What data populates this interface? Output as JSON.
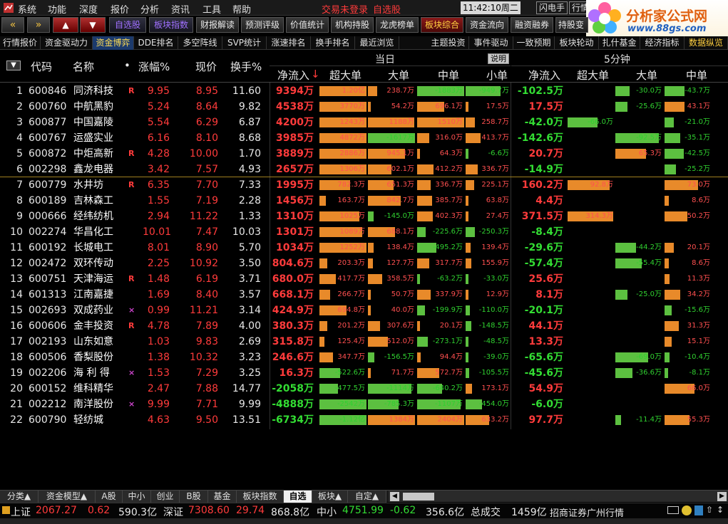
{
  "menubar": {
    "items": [
      "系统",
      "功能",
      "深度",
      "报价",
      "分析",
      "资讯",
      "工具",
      "帮助"
    ],
    "trade_status": "交易未登录",
    "watchlist": "自选股",
    "time": "11:42:10",
    "weekday": "周二",
    "right_items": [
      "闪电手",
      "行情",
      "资"
    ]
  },
  "logo": {
    "title": "分析家公式网",
    "url": "www.88gs.com"
  },
  "toolbar": {
    "nav_prev": "«",
    "nav_next": "»",
    "up": "▲",
    "down": "▼",
    "items": [
      "自选股",
      "板块指数",
      "财报解读",
      "预测评级",
      "价值统计",
      "机构持股",
      "龙虎榜单",
      "板块综合",
      "资金流向",
      "融资融券",
      "持股变"
    ]
  },
  "tabs": {
    "items": [
      "行情报价",
      "资金驱动力",
      "资金博弈",
      "DDE排名",
      "多空阵线",
      "SVP统计",
      "涨速排名",
      "换手排名",
      "最近浏览",
      "主题投资",
      "事件驱动",
      "一致预期",
      "板块轮动",
      "扎什基金",
      "经济指标",
      "数据纵览"
    ],
    "active": "资金博弈"
  },
  "header": {
    "group_today": "当日",
    "group_5min": "5分钟",
    "explain": "说明",
    "cols": [
      "代码",
      "名称",
      "涨幅%",
      "现价",
      "换手%",
      "净流入",
      "超大单",
      "大单",
      "中单",
      "小单",
      "净流入",
      "超大单",
      "大单",
      "中单"
    ],
    "dot": "•",
    "sort_arrow": "↓",
    "toggle": "▼"
  },
  "table": {
    "rows": [
      {
        "no": "1",
        "code": "600846",
        "name": "同济科技",
        "flag": "R",
        "chg": "9.95",
        "price": "8.95",
        "turn": "11.60",
        "net": "9394万",
        "xl": "1.20亿",
        "l": "238.7万",
        "m": "-1883万",
        "s": "-949.7万",
        "net5": "-102.5万",
        "xl5": "",
        "l5": "-30.0万",
        "m5": "-43.7万"
      },
      {
        "no": "2",
        "code": "600760",
        "name": "中航黑豹",
        "flag": "",
        "chg": "5.24",
        "price": "8.64",
        "turn": "9.82",
        "net": "4538万",
        "xl": "3770万",
        "l": "54.2万",
        "m": "696.1万",
        "s": "17.5万",
        "net5": "17.5万",
        "xl5": "",
        "l5": "-25.6万",
        "m5": "43.1万"
      },
      {
        "no": "3",
        "code": "600877",
        "name": "中国嘉陵",
        "flag": "",
        "chg": "5.54",
        "price": "6.29",
        "turn": "6.87",
        "net": "4200万",
        "xl": "1243万",
        "l": "1188万",
        "m": "1510万",
        "s": "258.7万",
        "net5": "-42.0万",
        "xl5": "-66.0万",
        "l5": "",
        "m5": "-21.0万"
      },
      {
        "no": "4",
        "code": "600767",
        "name": "运盛实业",
        "flag": "",
        "chg": "6.16",
        "price": "8.10",
        "turn": "8.68",
        "net": "3985万",
        "xl": "4872万",
        "l": "-1617万",
        "m": "316.0万",
        "s": "413.7万",
        "net5": "-142.6万",
        "xl5": "",
        "l5": "-92.5万",
        "m5": "-35.1万"
      },
      {
        "no": "5",
        "code": "600872",
        "name": "中炬高新",
        "flag": "R",
        "chg": "4.28",
        "price": "10.00",
        "turn": "1.70",
        "net": "3889万",
        "xl": "2886万",
        "l": "945.1万",
        "m": "64.3万",
        "s": "-6.6万",
        "net5": "20.7万",
        "xl5": "",
        "l5": "65.3万",
        "m5": "-42.5万"
      },
      {
        "no": "6",
        "code": "002298",
        "name": "鑫龙电器",
        "flag": "",
        "chg": "3.42",
        "price": "7.57",
        "turn": "4.93",
        "net": "2657万",
        "xl": "1306万",
        "l": "602.1万",
        "m": "412.2万",
        "s": "336.7万",
        "net5": "-14.9万",
        "xl5": "",
        "l5": "",
        "m5": "-25.2万"
      },
      {
        "no": "7",
        "code": "600779",
        "name": "水井坊",
        "flag": "R",
        "chg": "6.35",
        "price": "7.70",
        "turn": "7.33",
        "net": "1995万",
        "xl": "782.3万",
        "l": "651.3万",
        "m": "336.7万",
        "s": "225.1万",
        "net5": "160.2万",
        "xl5": "92.8万",
        "l5": "",
        "m5": "73.0万"
      },
      {
        "no": "8",
        "code": "600189",
        "name": "吉林森工",
        "flag": "",
        "chg": "1.55",
        "price": "7.19",
        "turn": "2.28",
        "net": "1456万",
        "xl": "163.7万",
        "l": "842.7万",
        "m": "385.7万",
        "s": "63.8万",
        "net5": "4.4万",
        "xl5": "",
        "l5": "",
        "m5": "8.6万"
      },
      {
        "no": "9",
        "code": "000666",
        "name": "经纬纺机",
        "flag": "",
        "chg": "2.94",
        "price": "11.22",
        "turn": "1.33",
        "net": "1310万",
        "xl": "1025万",
        "l": "-145.0万",
        "m": "402.3万",
        "s": "27.4万",
        "net5": "371.5万",
        "xl5": "314.3万",
        "l5": "",
        "m5": "50.2万"
      },
      {
        "no": "10",
        "code": "002274",
        "name": "华昌化工",
        "flag": "",
        "chg": "10.01",
        "price": "7.47",
        "turn": "10.03",
        "net": "1301万",
        "xl": "1089万",
        "l": "688.1万",
        "m": "-225.6万",
        "s": "-250.3万",
        "net5": "-8.4万",
        "xl5": "",
        "l5": "",
        "m5": ""
      },
      {
        "no": "11",
        "code": "600192",
        "name": "长城电工",
        "flag": "",
        "chg": "8.01",
        "price": "8.90",
        "turn": "5.70",
        "net": "1034万",
        "xl": "1252万",
        "l": "138.4万",
        "m": "-495.2万",
        "s": "139.4万",
        "net5": "-29.6万",
        "xl5": "",
        "l5": "-44.2万",
        "m5": "20.1万"
      },
      {
        "no": "12",
        "code": "002472",
        "name": "双环传动",
        "flag": "",
        "chg": "2.25",
        "price": "10.92",
        "turn": "3.50",
        "net": "804.6万",
        "xl": "203.3万",
        "l": "127.7万",
        "m": "317.7万",
        "s": "155.9万",
        "net5": "-57.4万",
        "xl5": "",
        "l5": "-55.4万",
        "m5": "8.6万"
      },
      {
        "no": "13",
        "code": "600751",
        "name": "天津海运",
        "flag": "R",
        "chg": "1.48",
        "price": "6.19",
        "turn": "3.71",
        "net": "680.0万",
        "xl": "417.7万",
        "l": "358.5万",
        "m": "-63.2万",
        "s": "-33.0万",
        "net5": "25.6万",
        "xl5": "",
        "l5": "",
        "m5": "11.3万"
      },
      {
        "no": "14",
        "code": "601313",
        "name": "江南嘉捷",
        "flag": "",
        "chg": "1.69",
        "price": "8.40",
        "turn": "3.57",
        "net": "668.1万",
        "xl": "266.7万",
        "l": "50.7万",
        "m": "337.9万",
        "s": "12.9万",
        "net5": "8.1万",
        "xl5": "",
        "l5": "-25.0万",
        "m5": "34.2万"
      },
      {
        "no": "15",
        "code": "002693",
        "name": "双成药业",
        "flag": "×",
        "chg": "0.99",
        "price": "11.21",
        "turn": "3.14",
        "net": "424.9万",
        "xl": "694.8万",
        "l": "40.0万",
        "m": "-199.9万",
        "s": "-110.0万",
        "net5": "-20.1万",
        "xl5": "",
        "l5": "",
        "m5": "-15.6万"
      },
      {
        "no": "16",
        "code": "600606",
        "name": "金丰投资",
        "flag": "R",
        "chg": "4.78",
        "price": "7.89",
        "turn": "4.00",
        "net": "380.3万",
        "xl": "201.2万",
        "l": "307.6万",
        "m": "20.1万",
        "s": "-148.5万",
        "net5": "44.1万",
        "xl5": "",
        "l5": "",
        "m5": "31.3万"
      },
      {
        "no": "17",
        "code": "002193",
        "name": "山东如意",
        "flag": "",
        "chg": "1.03",
        "price": "9.83",
        "turn": "2.69",
        "net": "315.8万",
        "xl": "125.4万",
        "l": "512.0万",
        "m": "-273.1万",
        "s": "-48.5万",
        "net5": "13.3万",
        "xl5": "",
        "l5": "",
        "m5": "15.1万"
      },
      {
        "no": "18",
        "code": "600506",
        "name": "香梨股份",
        "flag": "",
        "chg": "1.38",
        "price": "10.32",
        "turn": "3.23",
        "net": "246.6万",
        "xl": "347.7万",
        "l": "-156.5万",
        "m": "94.4万",
        "s": "-39.0万",
        "net5": "-65.6万",
        "xl5": "",
        "l5": "-69.0万",
        "m5": "-10.4万"
      },
      {
        "no": "19",
        "code": "002206",
        "name": "海 利 得",
        "flag": "×",
        "chg": "1.53",
        "price": "7.29",
        "turn": "3.25",
        "net": "16.3万",
        "xl": "-522.6万",
        "l": "71.7万",
        "m": "572.7万",
        "s": "-105.5万",
        "net5": "-45.6万",
        "xl5": "",
        "l5": "-36.6万",
        "m5": "-8.1万"
      },
      {
        "no": "20",
        "code": "600152",
        "name": "维科精华",
        "flag": "",
        "chg": "2.47",
        "price": "7.88",
        "turn": "14.77",
        "net": "-2058万",
        "xl": "-477.5万",
        "l": "-1114万",
        "m": "-640.2万",
        "s": "173.1万",
        "net5": "54.9万",
        "xl5": "",
        "l5": "",
        "m5": "66.0万"
      },
      {
        "no": "21",
        "code": "002212",
        "name": "南洋股份",
        "flag": "×",
        "chg": "9.99",
        "price": "7.71",
        "turn": "9.99",
        "net": "-4888万",
        "xl": "-2542万",
        "l": "-785.3万",
        "m": "-1107万",
        "s": "-454.0万",
        "net5": "-6.0万",
        "xl5": "",
        "l5": "",
        "m5": ""
      },
      {
        "no": "22",
        "code": "600790",
        "name": "轻纺城",
        "flag": "",
        "chg": "4.63",
        "price": "9.50",
        "turn": "13.51",
        "net": "-6734万",
        "xl": "-1.12亿",
        "l": "1384万",
        "m": "2404万",
        "s": "633.2万",
        "net5": "97.7万",
        "xl5": "",
        "l5": "-11.4万",
        "m5": "55.3万"
      }
    ]
  },
  "bottom_tabs": {
    "items": [
      "分类▲",
      "资金模型▲",
      "A股",
      "中小",
      "创业",
      "B股",
      "基金",
      "板块指数",
      "自选",
      "板块▲",
      "自定▲"
    ],
    "active": "自选"
  },
  "status": {
    "sh_label": "上证",
    "sh_index": "2067.27",
    "sh_chg": "0.62",
    "sh_amt": "590.3亿",
    "sz_label": "深证",
    "sz_index": "7308.60",
    "sz_chg": "29.74",
    "sz_amt": "868.8亿",
    "zx_label": "中小",
    "zx_index": "4751.99",
    "zx_chg": "-0.62",
    "zx_amt": "356.6亿",
    "total_label": "总成交",
    "total_amt": "1459亿",
    "broker": "招商证券广州行情"
  },
  "colors": {
    "up": "#ff3b3b",
    "down": "#33dd33",
    "inflow_bar": "#e88a2a",
    "outflow_bar": "#5cc040",
    "header_yellow": "#ffd040"
  }
}
